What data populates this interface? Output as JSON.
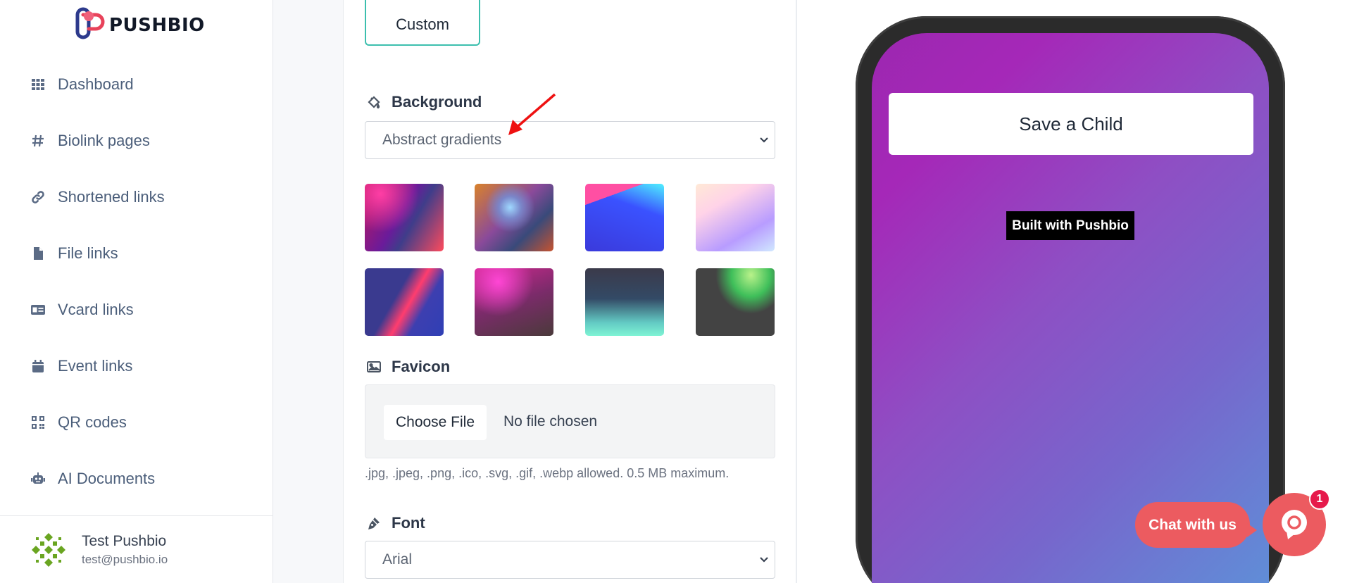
{
  "brand": {
    "name": "PUSHBIO"
  },
  "sidebar": {
    "items": [
      {
        "label": "Dashboard",
        "icon": "grid-icon"
      },
      {
        "label": "Biolink pages",
        "icon": "hash-icon"
      },
      {
        "label": "Shortened links",
        "icon": "link-icon"
      },
      {
        "label": "File links",
        "icon": "file-icon"
      },
      {
        "label": "Vcard links",
        "icon": "id-card-icon"
      },
      {
        "label": "Event links",
        "icon": "calendar-icon"
      },
      {
        "label": "QR codes",
        "icon": "qrcode-icon"
      },
      {
        "label": "AI Documents",
        "icon": "robot-icon"
      }
    ]
  },
  "user": {
    "name": "Test Pushbio",
    "email": "test@pushbio.io"
  },
  "editor": {
    "custom_label": "Custom",
    "background": {
      "label": "Background",
      "selected": "Abstract gradients"
    },
    "favicon": {
      "label": "Favicon",
      "choose_label": "Choose File",
      "status": "No file chosen",
      "hint": ".jpg, .jpeg, .png, .ico, .svg, .gif, .webp allowed. 0.5 MB maximum."
    },
    "font": {
      "label": "Font",
      "selected": "Arial"
    }
  },
  "preview": {
    "button_label": "Save a Child",
    "branding": "Built with Pushbio"
  },
  "chat": {
    "label": "Chat with us",
    "badge": "1"
  },
  "colors": {
    "accent": "#3cbfae",
    "chat": "#ec5b60",
    "badge": "#e6194b"
  }
}
